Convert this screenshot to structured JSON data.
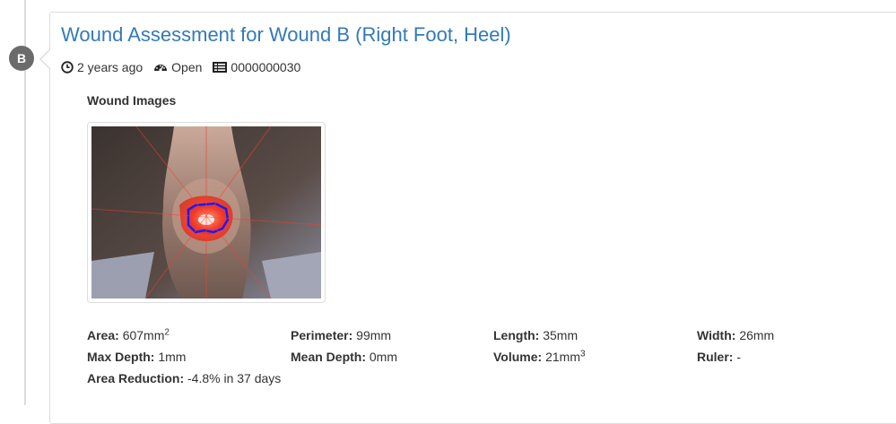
{
  "timeline": {
    "badge": "B"
  },
  "assessment": {
    "title": "Wound Assessment for Wound B (Right Foot, Heel)",
    "meta": {
      "time": "2 years ago",
      "status": "Open",
      "id": "0000000030"
    },
    "images_heading": "Wound Images",
    "stats": {
      "area_label": "Area:",
      "area_value": "607mm",
      "area_sup": "2",
      "perimeter_label": "Perimeter:",
      "perimeter_value": "99mm",
      "length_label": "Length:",
      "length_value": "35mm",
      "width_label": "Width:",
      "width_value": "26mm",
      "max_depth_label": "Max Depth:",
      "max_depth_value": "1mm",
      "mean_depth_label": "Mean Depth:",
      "mean_depth_value": "0mm",
      "volume_label": "Volume:",
      "volume_value": "21mm",
      "volume_sup": "3",
      "ruler_label": "Ruler:",
      "ruler_value": "-",
      "area_reduction_label": "Area Reduction:",
      "area_reduction_value": "-4.8% in 37 days"
    }
  },
  "icons": {
    "time": "clock-icon",
    "status": "dashboard-icon",
    "id": "list-icon"
  },
  "colors": {
    "link": "#337ab7",
    "badge": "#6b6b6b",
    "wound_outline": "#1a1aff"
  }
}
